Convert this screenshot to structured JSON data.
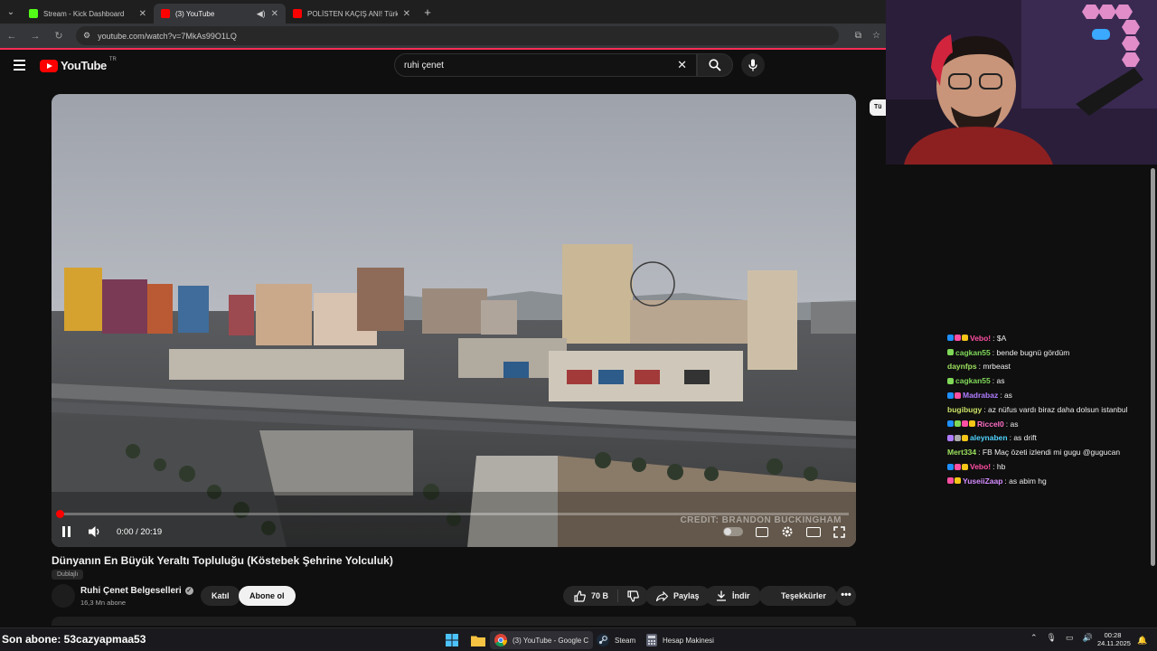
{
  "browser": {
    "tabs": [
      {
        "title": "Stream - Kick Dashboard",
        "color": "#53fc18",
        "active": false
      },
      {
        "title": "(3) YouTube",
        "color": "#ff0000",
        "active": true
      },
      {
        "title": "POLİSTEN KAÇIŞ ANI! Türkiye'd",
        "color": "#ff0000",
        "active": false
      }
    ],
    "url": "youtube.com/watch?v=7MkAs99O1LQ"
  },
  "youtube": {
    "logo_text": "YouTube",
    "country": "TR",
    "search_value": "ruhi çenet",
    "side_chip": "Tü",
    "player": {
      "time": "0:00 / 20:19",
      "progress": 0.0,
      "credit": "CREDIT: BRANDON BUCKINGHAM"
    },
    "video": {
      "title": "Dünyanın En Büyük Yeraltı Topluluğu (Köstebek Şehrine Yolculuk)",
      "badge": "Dublajlı",
      "channel": "Ruhi Çenet Belgeselleri",
      "subscribers": "16,3 Mn abone",
      "join_label": "Katıl",
      "subscribe_label": "Abone ol",
      "likes": "70 B",
      "share_label": "Paylaş",
      "download_label": "İndir",
      "thanks_label": "Teşekkürler"
    }
  },
  "chat": [
    {
      "user": "Vebo!",
      "color": "#ff4fa3",
      "badges": [
        "#1e90ff",
        "#ff4fa3",
        "#f5c518"
      ],
      "text": "$A"
    },
    {
      "user": "cagkan55",
      "color": "#7fd858",
      "badges": [
        "#7fd858"
      ],
      "text": "bende bugnü gördüm"
    },
    {
      "user": "daynfps",
      "color": "#9be15d",
      "badges": [],
      "text": "mrbeast"
    },
    {
      "user": "cagkan55",
      "color": "#7fd858",
      "badges": [
        "#7fd858"
      ],
      "text": "as"
    },
    {
      "user": "Madrabaz",
      "color": "#b07cff",
      "badges": [
        "#1e90ff",
        "#ff4fa3"
      ],
      "text": "as"
    },
    {
      "user": "bugibugy",
      "color": "#c9e265",
      "badges": [],
      "text": "az nüfus vardı biraz daha dolsun istanbul"
    },
    {
      "user": "Riccel0",
      "color": "#ff6ec7",
      "badges": [
        "#1e90ff",
        "#7fd858",
        "#ff4fa3",
        "#f5c518"
      ],
      "text": "as"
    },
    {
      "user": "aleynaben",
      "color": "#4fd3ff",
      "badges": [
        "#b07cff",
        "#aaaaaa",
        "#f5c518"
      ],
      "text": "as drift"
    },
    {
      "user": "Mert334",
      "color": "#9be15d",
      "badges": [],
      "text": "FB Maç özeti izlendi mi gugu @gugucan"
    },
    {
      "user": "Vebo!",
      "color": "#ff4fa3",
      "badges": [
        "#1e90ff",
        "#ff4fa3",
        "#f5c518"
      ],
      "text": "hb"
    },
    {
      "user": "YuseiiZaap",
      "color": "#d58cff",
      "badges": [
        "#ff4fa3",
        "#f5c518"
      ],
      "text": "as abim hg"
    }
  ],
  "taskbar": {
    "subscriber_text": "Son abone: 53cazyapmaa53",
    "apps": [
      {
        "label": "(3) YouTube - Google C",
        "active": true
      },
      {
        "label": "Steam",
        "active": false
      },
      {
        "label": "Hesap Makinesi",
        "active": false
      }
    ],
    "time": "00:28",
    "date": "24.11.2025"
  }
}
